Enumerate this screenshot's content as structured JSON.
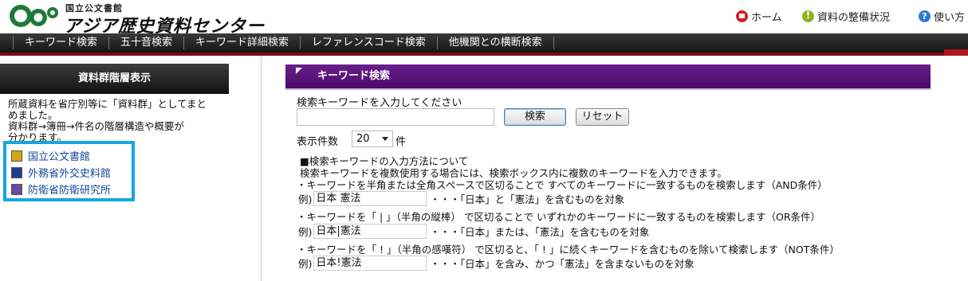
{
  "header": {
    "logo_sub": "国立公文書館",
    "logo_main": "アジア歴史資料センター",
    "links": [
      {
        "label": "ホーム",
        "icon": "home-icon"
      },
      {
        "label": "資料の整備状況",
        "icon": "info-icon"
      },
      {
        "label": "使い方",
        "icon": "help-icon"
      }
    ]
  },
  "nav": {
    "items": [
      "キーワード検索",
      "五十音検索",
      "キーワード詳細検索",
      "レファレンスコード検索",
      "他機関との横断検索"
    ]
  },
  "sidebar": {
    "title": "資料群階層表示",
    "description": [
      "所蔵資料を省庁別等に「資料群」としてまと",
      "めました。",
      "資料群→簿冊→件名の階層構造や概要が",
      "分かります。"
    ],
    "links": [
      {
        "label": "国立公文書館",
        "color": "#d4a417"
      },
      {
        "label": "外務省外交史料館",
        "color": "#1d3f8f"
      },
      {
        "label": "防衛省防衛研究所",
        "color": "#6a4aa0"
      }
    ]
  },
  "main": {
    "title": "キーワード検索",
    "input_label": "検索キーワードを入力してください",
    "search_value": "",
    "search_button": "検索",
    "reset_button": "リセット",
    "count_label": "表示件数",
    "count_value": "20",
    "count_unit": "件",
    "help_title": "■検索キーワードの入力方法について",
    "help_intro": "検索キーワードを複数使用する場合には、検索ボックス内に複数のキーワードを入力できます。",
    "rules": [
      {
        "text": "・キーワードを半角または全角スペースで区切ることで すべてのキーワードに一致するものを検索します（AND条件）",
        "example_prefix": "例)",
        "example": "日本 憲法",
        "explain": "・・・「日本」と「憲法」を含むものを対象"
      },
      {
        "text": "・キーワードを「 | 」（半角の縦棒） で区切ることで いずれかのキーワードに一致するものを検索します（OR条件）",
        "example_prefix": "例)",
        "example": "日本|憲法",
        "explain": "・・・「日本」または、「憲法」を含むものを対象"
      },
      {
        "text": "・キーワードを「 ! 」（半角の感嘆符） で区切ると、「 ! 」に続くキーワードを含むものを除いて検索します（NOT条件）",
        "example_prefix": "例)",
        "example": "日本!憲法",
        "explain": "・・・「日本」を含み、かつ「憲法」を含まないものを対象"
      }
    ]
  },
  "colors": {
    "nav_bg": "#1e1e1e",
    "accent_purple": "#5a1280",
    "sidebar_box_border": "#15a6dd",
    "link_blue": "#14489a"
  }
}
